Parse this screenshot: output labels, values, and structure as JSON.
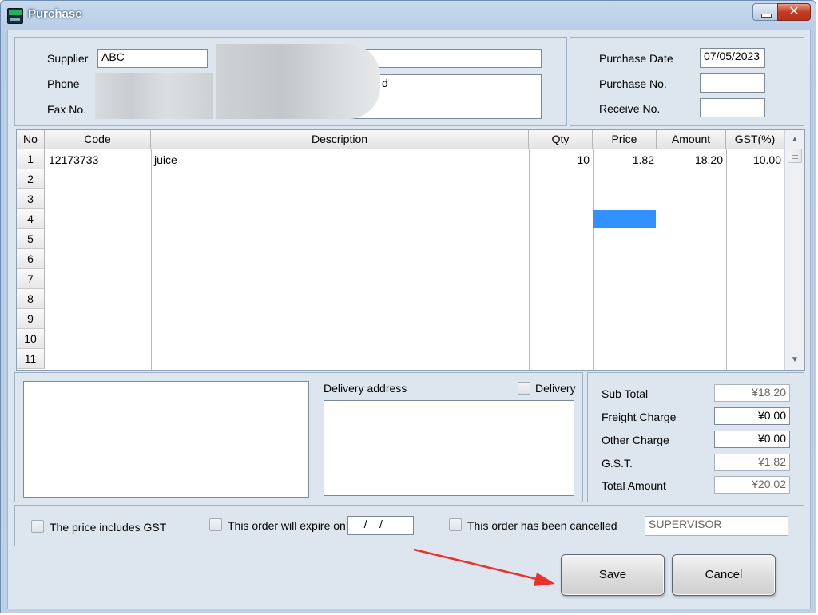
{
  "window": {
    "title": "Purchase",
    "close_glyph": "✕"
  },
  "supplier": {
    "supplier_label": "Supplier",
    "supplier_code": "ABC",
    "supplier_name": "",
    "phone_label": "Phone",
    "fax_label": "Fax No.",
    "address_tail": "d"
  },
  "purchase_info": {
    "date_label": "Purchase Date",
    "date_value": "07/05/2023",
    "purchase_no_label": "Purchase No.",
    "purchase_no_value": "",
    "receive_no_label": "Receive No.",
    "receive_no_value": ""
  },
  "grid": {
    "columns": [
      "No",
      "Code",
      "Description",
      "Qty",
      "Price",
      "Amount",
      "GST(%)"
    ],
    "row_numbers": [
      "1",
      "2",
      "3",
      "4",
      "5",
      "6",
      "7",
      "8",
      "9",
      "10",
      "11"
    ],
    "rows": [
      {
        "code": "12173733",
        "description": "juice",
        "qty": "10",
        "price": "1.82",
        "amount": "18.20",
        "gst": "10.00"
      }
    ],
    "scroll_up_glyph": "▲",
    "scroll_down_glyph": "▼"
  },
  "delivery": {
    "address_label": "Delivery address",
    "checkbox_label": "Delivery",
    "address_value": "",
    "notes_value": ""
  },
  "totals": {
    "subtotal_label": "Sub Total",
    "subtotal_value": "¥18.20",
    "freight_label": "Freight Charge",
    "freight_value": "¥0.00",
    "other_label": "Other Charge",
    "other_value": "¥0.00",
    "gst_label": "G.S.T.",
    "gst_value": "¥1.82",
    "total_label": "Total Amount",
    "total_value": "¥20.02"
  },
  "options": {
    "includes_gst_label": "The price includes GST",
    "expire_label": "This order will expire on",
    "expire_value": "__/__/____",
    "cancelled_label": "This order has been cancelled",
    "user_value": "SUPERVISOR"
  },
  "buttons": {
    "save_label": "Save",
    "cancel_label": "Cancel"
  },
  "colors": {
    "selection": "#3391ff",
    "annotation_arrow": "#e8322a"
  }
}
